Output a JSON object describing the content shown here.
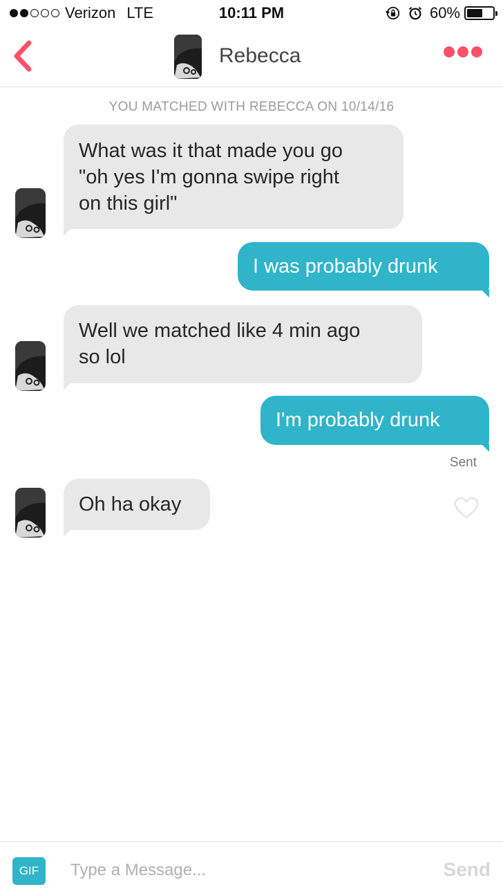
{
  "status_bar": {
    "signal_bars_filled": 2,
    "signal_bars_total": 5,
    "carrier": "Verizon",
    "network": "LTE",
    "time": "10:11 PM",
    "icons": [
      "rotation-lock-icon",
      "alarm-icon"
    ],
    "battery_percent": "60%",
    "battery_level": 0.6
  },
  "header": {
    "back_icon": "chevron-left-icon",
    "contact_name": "Rebecca",
    "more_icon": "more-dots-icon",
    "accent_color": "#fd5068"
  },
  "match_notice": "YOU MATCHED WITH REBECCA ON 10/14/16",
  "messages": [
    {
      "direction": "incoming",
      "lines": [
        "What was it that made you go",
        "\"oh yes I'm gonna swipe right",
        "on this girl\""
      ]
    },
    {
      "direction": "outgoing",
      "lines": [
        "I was probably drunk"
      ]
    },
    {
      "direction": "incoming",
      "lines": [
        "Well we matched like 4 min ago",
        "so lol"
      ]
    },
    {
      "direction": "outgoing",
      "lines": [
        "I'm probably drunk"
      ]
    },
    {
      "direction": "incoming",
      "lines": [
        "Oh ha okay"
      ]
    }
  ],
  "sent_status": "Sent",
  "like_icon": "heart-outline-icon",
  "composer": {
    "gif_label": "GIF",
    "placeholder": "Type a Message...",
    "send_label": "Send"
  },
  "colors": {
    "outgoing_bubble": "#30b4c9",
    "incoming_bubble": "#e8e8e8"
  }
}
